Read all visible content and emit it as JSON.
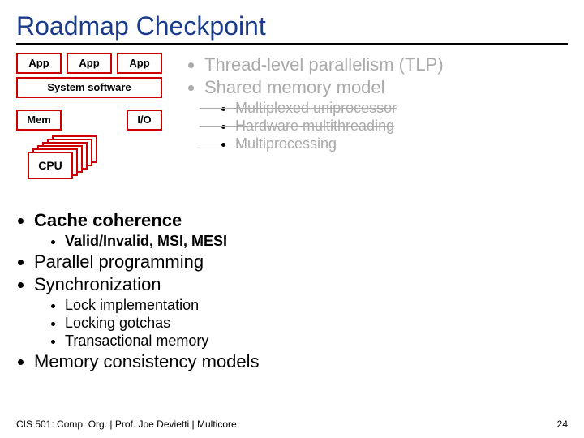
{
  "title": "Roadmap Checkpoint",
  "diagram": {
    "app": "App",
    "sys": "System software",
    "mem": "Mem",
    "io": "I/O",
    "cpu": "CPU"
  },
  "bullets": {
    "tlp": "Thread-level parallelism (TLP)",
    "smm": "Shared memory model",
    "mux": "Multiplexed uniprocessor",
    "hmt": "Hardware multithreading",
    "mp": "Multiprocessing",
    "cc": "Cache coherence",
    "vi": "Valid/Invalid, MSI, MESI",
    "pp": "Parallel programming",
    "sync": "Synchronization",
    "lock": "Lock implementation",
    "gotchas": "Locking gotchas",
    "tm": "Transactional memory",
    "mcm": "Memory consistency models"
  },
  "footer": {
    "left": "CIS 501: Comp. Org. |  Prof. Joe Devietti  |  Multicore",
    "page": "24"
  }
}
